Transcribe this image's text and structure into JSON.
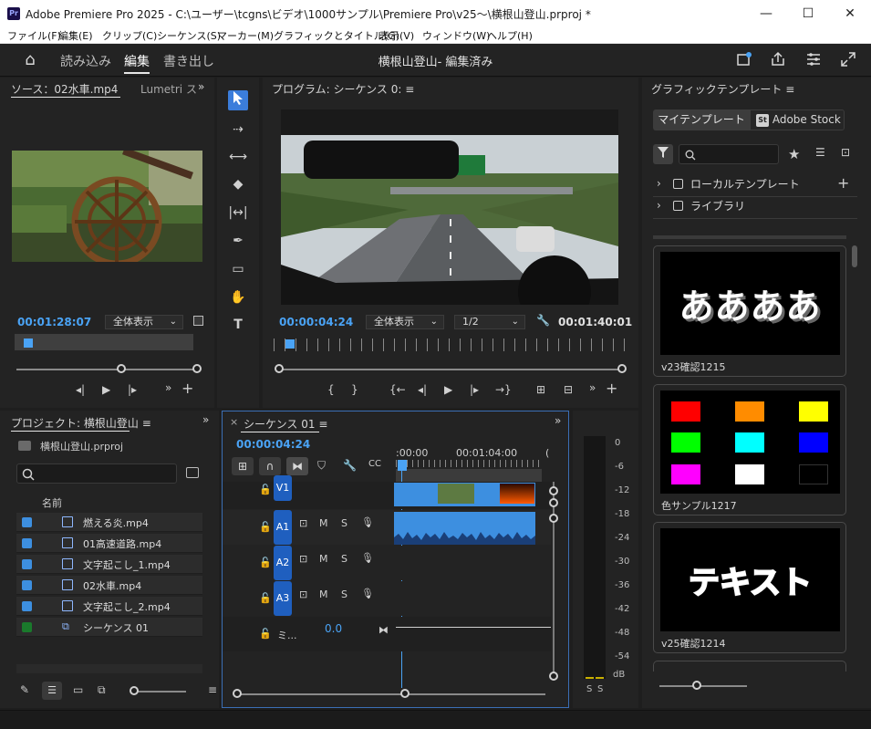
{
  "window": {
    "title": "Adobe Premiere Pro 2025 - C:\\ユーザー\\tcgns\\ビデオ\\1000サンプル\\Premiere Pro\\v25～\\横根山登山.prproj *",
    "app_icon": "Pr",
    "minimize": "—",
    "maximize": "☐",
    "close": "✕"
  },
  "menu": [
    "ファイル(F)",
    "編集(E)",
    "クリップ(C)",
    "シーケンス(S)",
    "マーカー(M)",
    "グラフィックとタイトル(G)",
    "表示(V)",
    "ウィンドウ(W)",
    "ヘルプ(H)"
  ],
  "workspace": {
    "home_icon": "⌂",
    "tabs": [
      {
        "label": "読み込み",
        "active": false
      },
      {
        "label": "編集",
        "active": true
      },
      {
        "label": "書き出し",
        "active": false
      }
    ],
    "doc_title": "横根山登山- 編集済み",
    "icons": [
      "feedback-icon",
      "share-icon",
      "panels-icon",
      "fullscreen-icon"
    ]
  },
  "source": {
    "tab": "ソース：02水車.mp4",
    "tab2": "Lumetri ス",
    "more": "≡",
    "timecode": "00:01:28:07",
    "fit": "全体表示"
  },
  "program": {
    "tab": "プログラム: シーケンス 0:",
    "more": "≡",
    "timecode": "00:00:04:24",
    "fit": "全体表示",
    "quality": "1/2",
    "duration": "00:01:40:01"
  },
  "project": {
    "tab": "プロジェクト: 横根山登山",
    "more": "≡",
    "file": "横根山登山.prproj",
    "column": "名前",
    "items": [
      {
        "name": "燃える炎.mp4",
        "color": "#3d8fe0"
      },
      {
        "name": "01高速道路.mp4",
        "color": "#3d8fe0"
      },
      {
        "name": "文字起こし_1.mp4",
        "color": "#3d8fe0"
      },
      {
        "name": "02水車.mp4",
        "color": "#3d8fe0"
      },
      {
        "name": "文字起こし_2.mp4",
        "color": "#3d8fe0"
      },
      {
        "name": "シーケンス 01",
        "color": "#1a7a2c"
      }
    ]
  },
  "timeline": {
    "tab": "シーケンス 01",
    "more": "≡",
    "close": "×",
    "timecode": "00:00:04:24",
    "ruler": [
      ":00:00",
      "00:01:04:00"
    ],
    "tracks": [
      {
        "label": "V1"
      },
      {
        "label": "A1",
        "m": "M",
        "s": "S"
      },
      {
        "label": "A2",
        "m": "M",
        "s": "S"
      },
      {
        "label": "A3",
        "m": "M",
        "s": "S"
      }
    ],
    "master_label": "ミ...",
    "master_value": "0.0"
  },
  "meter": {
    "labels": [
      "0",
      "-6",
      "-12",
      "-18",
      "-24",
      "-30",
      "-36",
      "-42",
      "-48",
      "-54",
      "dB"
    ],
    "solo": [
      "S",
      "S"
    ]
  },
  "graphics": {
    "tab": "グラフィックテンプレート",
    "more": "≡",
    "tabs": [
      {
        "label": "マイテンプレート",
        "active": true
      },
      {
        "label": "Adobe Stock",
        "active": false
      }
    ],
    "stock_badge": "St",
    "tree": [
      {
        "label": "ローカルテンプレート"
      },
      {
        "label": "ライブラリ"
      }
    ],
    "templates": [
      {
        "caption": "v23確認1215",
        "text": "ああああ"
      },
      {
        "caption": "色サンプル1217"
      },
      {
        "caption": "v25確認1214",
        "text": "テキスト"
      }
    ],
    "swatches": [
      "#ff0000",
      "#ff8c00",
      "#ffff00",
      "#00ff00",
      "#00ffff",
      "#0000ff",
      "#ff00ff",
      "#ffffff",
      "#000000"
    ]
  }
}
